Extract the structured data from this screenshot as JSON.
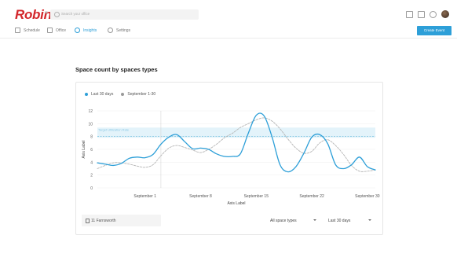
{
  "app": {
    "brand": "Robin",
    "search_placeholder": "Search your office"
  },
  "nav": {
    "items": [
      {
        "label": "Schedule",
        "icon": "calendar-icon"
      },
      {
        "label": "Office",
        "icon": "building-icon"
      },
      {
        "label": "Insights",
        "icon": "insights-icon",
        "active": true
      },
      {
        "label": "Settings",
        "icon": "gear-icon"
      }
    ],
    "create_button": "Create Event"
  },
  "section": {
    "title": "Space count by spaces types"
  },
  "legend": [
    {
      "label": "Last 30 days",
      "color": "#2d9fd8"
    },
    {
      "label": "September 1-30",
      "color": "#9a9a9a"
    }
  ],
  "chart_data": {
    "type": "line",
    "title": "",
    "xlabel": "Axis Label",
    "ylabel": "Axis Label",
    "ylim": [
      0,
      12
    ],
    "y_ticks": [
      0,
      2,
      4,
      6,
      8,
      10,
      12
    ],
    "x_tick_labels": [
      {
        "label": "September 1",
        "x": 6
      },
      {
        "label": "September 8",
        "x": 13
      },
      {
        "label": "September 15",
        "x": 20
      },
      {
        "label": "September 22",
        "x": 27
      },
      {
        "label": "September 30",
        "x": 34
      }
    ],
    "xlim": [
      0,
      35
    ],
    "target": {
      "label": "Target Utilization Rate",
      "value": 8,
      "band": [
        7.8,
        9.4
      ]
    },
    "cursor_x": 8,
    "series": [
      {
        "name": "Last 30 days",
        "color": "#2d9fd8",
        "style": "solid",
        "x": [
          0,
          1,
          2,
          3,
          4,
          5,
          6,
          7,
          8,
          9,
          10,
          11,
          12,
          13,
          14,
          15,
          16,
          17,
          18,
          19,
          20,
          21,
          22,
          23,
          24,
          25,
          26,
          27,
          28,
          29,
          30,
          31,
          32,
          33,
          34,
          35
        ],
        "values": [
          3.9,
          3.7,
          3.5,
          3.8,
          4.6,
          4.8,
          4.7,
          5.2,
          6.8,
          7.9,
          8.3,
          7.2,
          6.1,
          6.2,
          6.0,
          5.3,
          4.9,
          4.9,
          5.3,
          8.5,
          11.3,
          11.2,
          7.9,
          3.6,
          2.5,
          3.3,
          5.4,
          7.9,
          8.3,
          6.9,
          3.6,
          3.0,
          3.6,
          4.8,
          3.3,
          2.8
        ]
      },
      {
        "name": "September 1-30",
        "color": "#b5b5b5",
        "style": "dashed",
        "x": [
          0,
          1,
          2,
          3,
          4,
          5,
          6,
          7,
          8,
          9,
          10,
          11,
          12,
          13,
          14,
          15,
          16,
          17,
          18,
          19,
          20,
          21,
          22,
          23,
          24,
          25,
          26,
          27,
          28,
          29,
          30,
          31,
          32,
          33,
          34,
          35
        ],
        "values": [
          3.0,
          3.5,
          3.9,
          3.9,
          3.7,
          3.4,
          3.2,
          3.6,
          5.0,
          6.2,
          6.6,
          6.3,
          5.9,
          5.5,
          6.0,
          6.8,
          7.8,
          8.5,
          9.4,
          10.0,
          10.6,
          10.9,
          10.4,
          9.2,
          7.6,
          6.2,
          5.4,
          5.7,
          7.0,
          7.5,
          6.6,
          5.2,
          3.5,
          2.6,
          2.6,
          2.8
        ]
      }
    ]
  },
  "filters": {
    "location": "11 Farnsworth",
    "space_types": "All space types",
    "range": "Last 30 days"
  }
}
